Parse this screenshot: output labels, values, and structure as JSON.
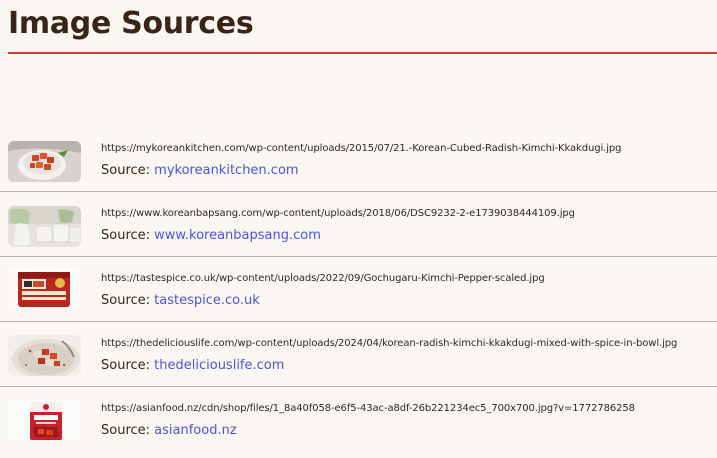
{
  "page": {
    "title": "Image Sources"
  },
  "source_prefix": "Source:",
  "colors": {
    "heading": "#3a2418",
    "accent_rule": "#d8332a",
    "link": "#4a56d6",
    "divider": "#b7b2ac",
    "background": "#faf7f2"
  },
  "sources": [
    {
      "url": "https://mykoreankitchen.com/wp-content/uploads/2015/07/21.-Korean-Cubed-Radish-Kimchi-Kkakdugi.jpg",
      "label": "mykoreankitchen.com",
      "thumb_icon": "kimchi-bowl-thumbnail"
    },
    {
      "url": "https://www.koreanbapsang.com/wp-content/uploads/2018/06/DSC9232-2-e1739038444109.jpg",
      "label": "www.koreanbapsang.com",
      "thumb_icon": "radish-thumbnail"
    },
    {
      "url": "https://tastespice.co.uk/wp-content/uploads/2022/09/Gochugaru-Kimchi-Pepper-scaled.jpg",
      "label": "tastespice.co.uk",
      "thumb_icon": "gochugaru-tin-thumbnail"
    },
    {
      "url": "https://thedeliciouslife.com/wp-content/uploads/2024/04/korean-radish-kimchi-kkakdugi-mixed-with-spice-in-bowl.jpg",
      "label": "thedeliciouslife.com",
      "thumb_icon": "spiced-radish-bowl-thumbnail"
    },
    {
      "url": "https://asianfood.nz/cdn/shop/files/1_8a40f058-e6f5-43ac-a8df-26b221234ec5_700x700.jpg?v=1772786258",
      "label": "asianfood.nz",
      "thumb_icon": "kimchi-package-thumbnail"
    }
  ]
}
